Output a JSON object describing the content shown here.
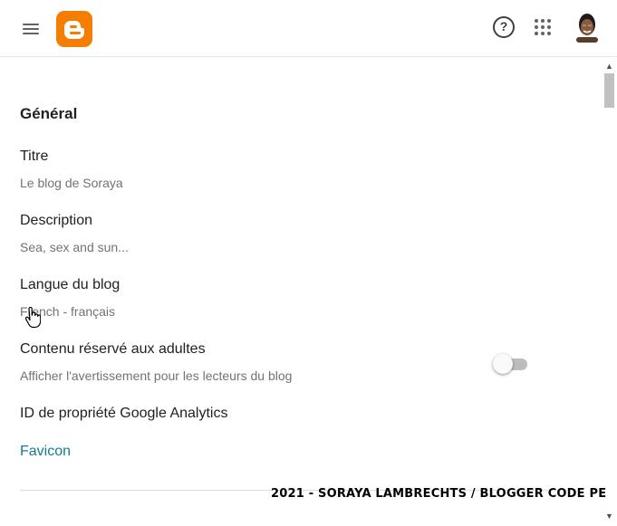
{
  "header": {
    "menu_icon": "hamburger-menu-icon",
    "logo_icon": "blogger-logo-icon",
    "help_glyph": "?",
    "help_icon": "help-circle-icon",
    "apps_icon": "apps-grid-icon",
    "avatar_icon": "user-avatar-icon"
  },
  "colors": {
    "brand": "#f57d00",
    "link": "#137c8b",
    "muted_text": "#6f7378"
  },
  "general": {
    "title": "Général",
    "settings": [
      {
        "label": "Titre",
        "value": "Le blog de Soraya"
      },
      {
        "label": "Description",
        "value": "Sea, sex and sun..."
      },
      {
        "label": "Langue du blog",
        "value": "French - français"
      },
      {
        "label": "Contenu réservé aux adultes",
        "value": "Afficher l'avertissement pour les lecteurs du blog",
        "toggle_on": false
      },
      {
        "label": "ID de propriété Google Analytics"
      }
    ],
    "favicon_label": "Favicon"
  },
  "watermark": "2021 - SORAYA LAMBRECHTS / BLOGGER CODE PE",
  "scrollbar": {
    "up_glyph": "▲",
    "down_glyph": "▼"
  }
}
